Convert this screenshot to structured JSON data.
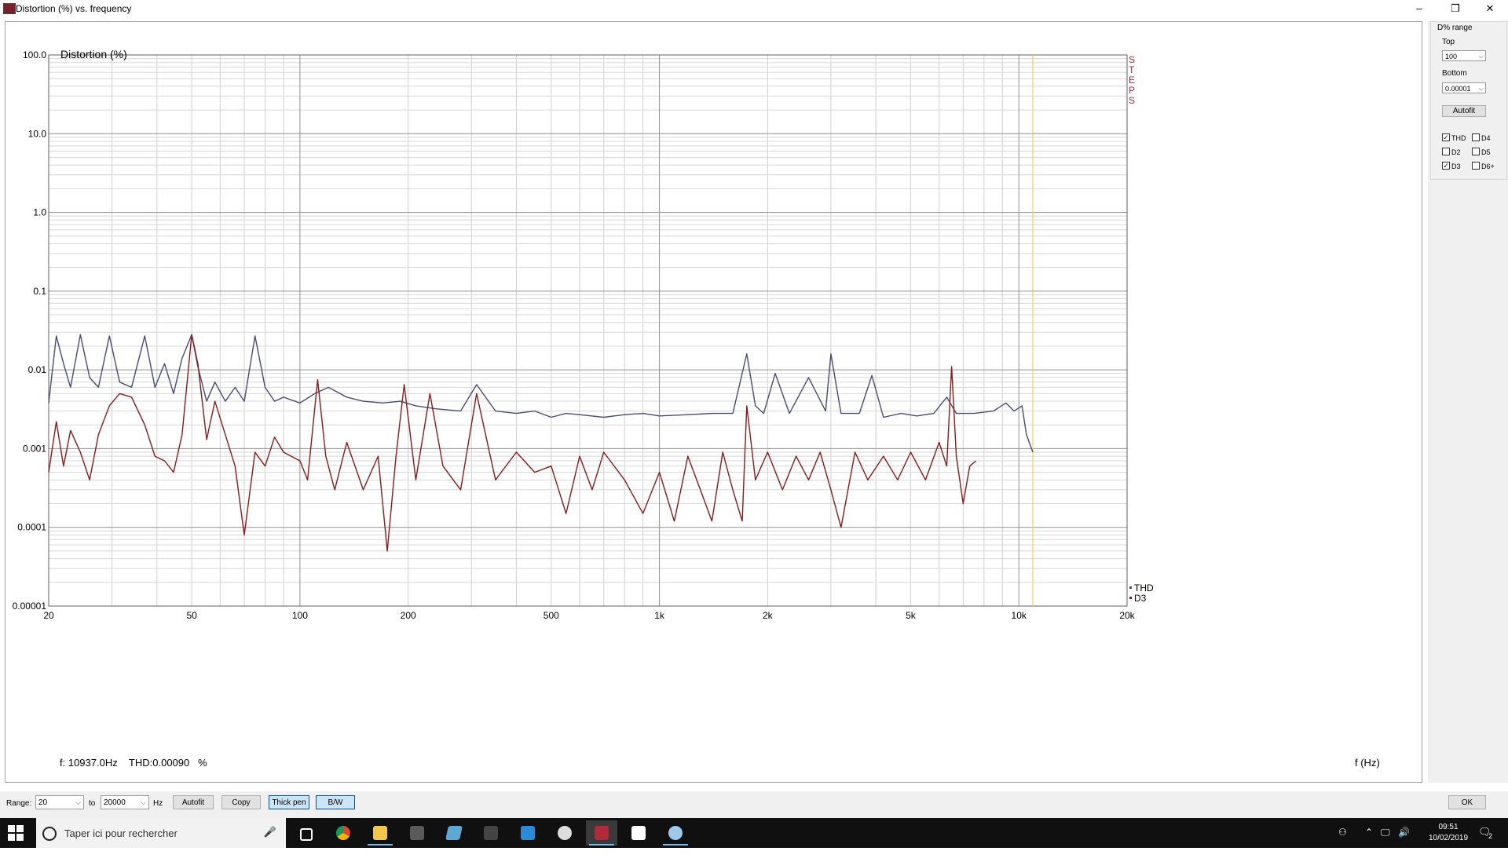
{
  "window": {
    "title": "Distortion (%) vs. frequency",
    "min": "–",
    "max": "❐",
    "close": "✕"
  },
  "chart": {
    "y_title": "Distortion (%)",
    "steps_label": [
      "S",
      "T",
      "E",
      "P",
      "S"
    ],
    "y_ticks": [
      "100.0",
      "10.0",
      "1.0",
      "0.1",
      "0.01",
      "0.001",
      "0.0001",
      "0.00001"
    ],
    "x_ticks": [
      "20",
      "50",
      "100",
      "200",
      "500",
      "1k",
      "2k",
      "5k",
      "10k",
      "20k"
    ],
    "x_unit": "f (Hz)",
    "cursor_readout": "f: 10937.0Hz    THD:0.00090   %",
    "legend": [
      {
        "name": "THD",
        "color": "#4a4a78"
      },
      {
        "name": "D3",
        "color": "#8b1a1a"
      }
    ]
  },
  "chart_data": {
    "type": "line",
    "title": "",
    "ylabel": "Distortion (%)",
    "xlabel": "f (Hz)",
    "x_scale": "log",
    "y_scale": "log",
    "xlim": [
      20,
      20000
    ],
    "ylim": [
      1e-05,
      100
    ],
    "grid": true,
    "legend_position": "bottom-right",
    "cursor_x": 10937,
    "series": [
      {
        "name": "THD",
        "color": "#4a4a78",
        "points": [
          [
            20,
            0.0038
          ],
          [
            21,
            0.027
          ],
          [
            22,
            0.012
          ],
          [
            23,
            0.006
          ],
          [
            24.5,
            0.028
          ],
          [
            26,
            0.008
          ],
          [
            27.5,
            0.006
          ],
          [
            29.5,
            0.027
          ],
          [
            31.5,
            0.007
          ],
          [
            34,
            0.006
          ],
          [
            37,
            0.027
          ],
          [
            39.5,
            0.006
          ],
          [
            42,
            0.012
          ],
          [
            44.5,
            0.005
          ],
          [
            47,
            0.014
          ],
          [
            50,
            0.028
          ],
          [
            52,
            0.011
          ],
          [
            55,
            0.004
          ],
          [
            58,
            0.007
          ],
          [
            62,
            0.004
          ],
          [
            66,
            0.006
          ],
          [
            70,
            0.004
          ],
          [
            75,
            0.027
          ],
          [
            80,
            0.006
          ],
          [
            85,
            0.004
          ],
          [
            90,
            0.0045
          ],
          [
            100,
            0.0038
          ],
          [
            110,
            0.005
          ],
          [
            120,
            0.006
          ],
          [
            135,
            0.0045
          ],
          [
            150,
            0.004
          ],
          [
            170,
            0.0038
          ],
          [
            190,
            0.004
          ],
          [
            210,
            0.0035
          ],
          [
            240,
            0.0032
          ],
          [
            280,
            0.003
          ],
          [
            310,
            0.0065
          ],
          [
            350,
            0.003
          ],
          [
            400,
            0.0028
          ],
          [
            450,
            0.003
          ],
          [
            500,
            0.0025
          ],
          [
            550,
            0.0028
          ],
          [
            600,
            0.0027
          ],
          [
            700,
            0.0025
          ],
          [
            800,
            0.0027
          ],
          [
            900,
            0.0028
          ],
          [
            1000,
            0.0026
          ],
          [
            1200,
            0.0027
          ],
          [
            1400,
            0.0028
          ],
          [
            1600,
            0.0028
          ],
          [
            1750,
            0.016
          ],
          [
            1850,
            0.0035
          ],
          [
            1950,
            0.0028
          ],
          [
            2100,
            0.009
          ],
          [
            2300,
            0.0028
          ],
          [
            2600,
            0.008
          ],
          [
            2900,
            0.003
          ],
          [
            3000,
            0.016
          ],
          [
            3200,
            0.0028
          ],
          [
            3600,
            0.0028
          ],
          [
            3900,
            0.0085
          ],
          [
            4200,
            0.0025
          ],
          [
            4700,
            0.0028
          ],
          [
            5200,
            0.0026
          ],
          [
            5800,
            0.0028
          ],
          [
            6300,
            0.0045
          ],
          [
            6700,
            0.0028
          ],
          [
            7500,
            0.0028
          ],
          [
            8500,
            0.003
          ],
          [
            9200,
            0.0038
          ],
          [
            9700,
            0.003
          ],
          [
            10200,
            0.0035
          ],
          [
            10500,
            0.0015
          ],
          [
            10937,
            0.0009
          ]
        ]
      },
      {
        "name": "D3",
        "color": "#8b1a1a",
        "points": [
          [
            20,
            0.0005
          ],
          [
            21,
            0.0022
          ],
          [
            22,
            0.0006
          ],
          [
            23,
            0.0017
          ],
          [
            24.5,
            0.0009
          ],
          [
            26,
            0.0004
          ],
          [
            27.5,
            0.0015
          ],
          [
            29.5,
            0.0035
          ],
          [
            31.5,
            0.005
          ],
          [
            34,
            0.0045
          ],
          [
            37,
            0.002
          ],
          [
            39.5,
            0.0008
          ],
          [
            42,
            0.0007
          ],
          [
            44.5,
            0.0005
          ],
          [
            47,
            0.0015
          ],
          [
            50,
            0.028
          ],
          [
            52,
            0.012
          ],
          [
            55,
            0.0013
          ],
          [
            58,
            0.004
          ],
          [
            62,
            0.0015
          ],
          [
            66,
            0.0006
          ],
          [
            70,
            8e-05
          ],
          [
            75,
            0.0009
          ],
          [
            80,
            0.0006
          ],
          [
            85,
            0.0014
          ],
          [
            90,
            0.0009
          ],
          [
            100,
            0.0007
          ],
          [
            105,
            0.0004
          ],
          [
            112,
            0.0075
          ],
          [
            118,
            0.0008
          ],
          [
            125,
            0.0003
          ],
          [
            135,
            0.0012
          ],
          [
            150,
            0.0003
          ],
          [
            165,
            0.0008
          ],
          [
            175,
            5e-05
          ],
          [
            185,
            0.0008
          ],
          [
            195,
            0.0065
          ],
          [
            210,
            0.0004
          ],
          [
            230,
            0.005
          ],
          [
            250,
            0.0006
          ],
          [
            280,
            0.0003
          ],
          [
            310,
            0.005
          ],
          [
            350,
            0.0004
          ],
          [
            400,
            0.0009
          ],
          [
            450,
            0.0005
          ],
          [
            500,
            0.0006
          ],
          [
            550,
            0.00015
          ],
          [
            600,
            0.0008
          ],
          [
            650,
            0.0003
          ],
          [
            700,
            0.0009
          ],
          [
            800,
            0.0004
          ],
          [
            900,
            0.00015
          ],
          [
            1000,
            0.0005
          ],
          [
            1100,
            0.00012
          ],
          [
            1200,
            0.0008
          ],
          [
            1300,
            0.0003
          ],
          [
            1400,
            0.00012
          ],
          [
            1500,
            0.0009
          ],
          [
            1600,
            0.0003
          ],
          [
            1700,
            0.00012
          ],
          [
            1750,
            0.0035
          ],
          [
            1850,
            0.0004
          ],
          [
            2000,
            0.0009
          ],
          [
            2200,
            0.0003
          ],
          [
            2400,
            0.0008
          ],
          [
            2600,
            0.0004
          ],
          [
            2800,
            0.0009
          ],
          [
            3000,
            0.0003
          ],
          [
            3200,
            0.0001
          ],
          [
            3500,
            0.0009
          ],
          [
            3800,
            0.0004
          ],
          [
            4200,
            0.0008
          ],
          [
            4600,
            0.0004
          ],
          [
            5000,
            0.0009
          ],
          [
            5500,
            0.0004
          ],
          [
            6000,
            0.0012
          ],
          [
            6300,
            0.0006
          ],
          [
            6500,
            0.011
          ],
          [
            6700,
            0.0008
          ],
          [
            7000,
            0.0002
          ],
          [
            7300,
            0.0006
          ],
          [
            7600,
            0.0007
          ]
        ]
      }
    ]
  },
  "side_panel": {
    "group_title": "D% range",
    "top_label": "Top",
    "top_value": "100",
    "bottom_label": "Bottom",
    "bottom_value": "0.00001",
    "autofit": "Autofit",
    "checkboxes": [
      {
        "label": "THD",
        "checked": true
      },
      {
        "label": "D4",
        "checked": false
      },
      {
        "label": "D2",
        "checked": false
      },
      {
        "label": "D5",
        "checked": false
      },
      {
        "label": "D3",
        "checked": true
      },
      {
        "label": "D6+",
        "checked": false
      }
    ]
  },
  "bottom_bar": {
    "range_label": "Range:",
    "range_from": "20",
    "to_label": "to",
    "range_to": "20000",
    "hz_label": "Hz",
    "autofit": "Autofit",
    "copy": "Copy",
    "thick_pen": "Thick pen",
    "bw": "B/W",
    "ok": "OK"
  },
  "taskbar": {
    "search_placeholder": "Taper ici pour rechercher",
    "time": "09:51",
    "date": "10/02/2019",
    "notifications": "2"
  }
}
